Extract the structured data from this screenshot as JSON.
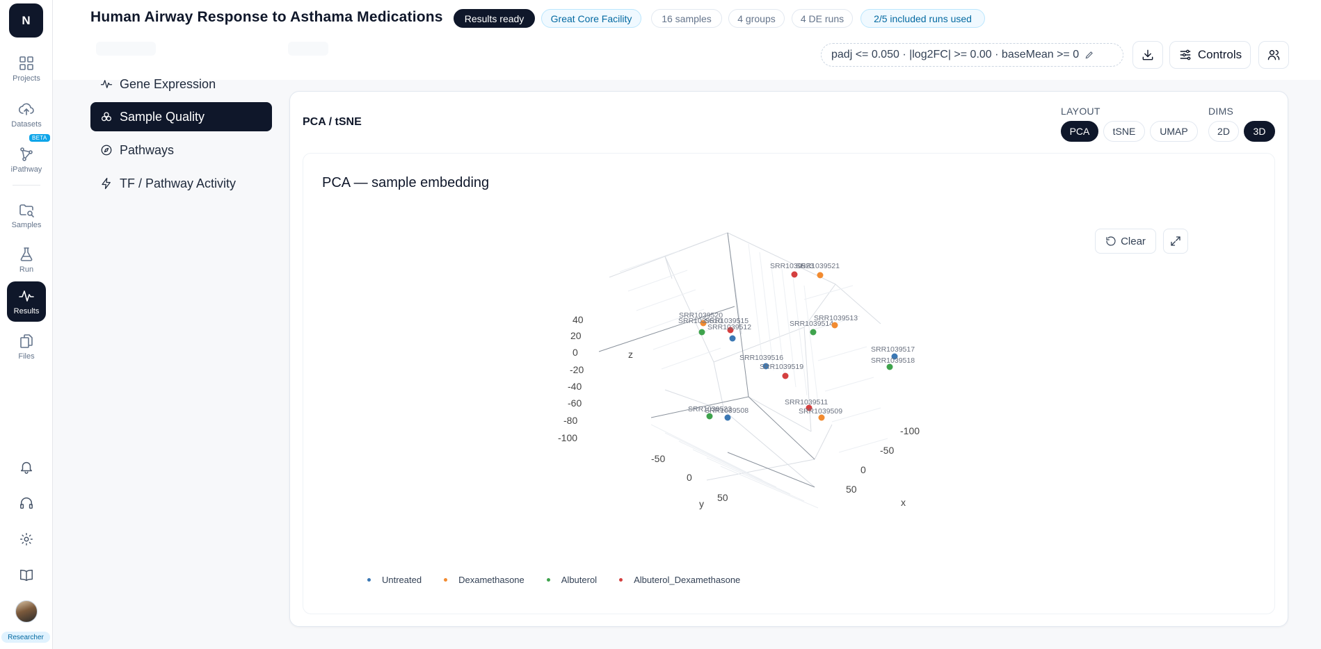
{
  "app": {
    "logo_letter": "N",
    "title": "Human Airway Response to Asthama Medications",
    "role": "Researcher"
  },
  "badges": {
    "status": "Results ready",
    "facility": "Great Core Facility",
    "samples": "16 samples",
    "groups": "4 groups",
    "de_runs": "4 DE runs",
    "runs_used": "2/5 included runs used"
  },
  "filter_text": "padj <= 0.050 · |log2FC| >= 0.00 · baseMean >= 0",
  "controls_label": "Controls",
  "rail": [
    {
      "label": "Projects",
      "icon": "grid-icon"
    },
    {
      "label": "Datasets",
      "icon": "cloud-upload-icon"
    },
    {
      "label": "iPathway",
      "icon": "network-icon"
    },
    {
      "label": "Samples",
      "icon": "folder-search-icon"
    },
    {
      "label": "Run",
      "icon": "flask-icon"
    },
    {
      "label": "Results",
      "icon": "activity-icon"
    },
    {
      "label": "Files",
      "icon": "files-icon"
    }
  ],
  "beta_label": "BETA",
  "subnav": [
    {
      "label": "Gene Expression",
      "icon": "activity-icon"
    },
    {
      "label": "Sample Quality",
      "icon": "circles-icon",
      "active": true
    },
    {
      "label": "Pathways",
      "icon": "compass-icon"
    },
    {
      "label": "TF / Pathway Activity",
      "icon": "zap-icon"
    }
  ],
  "panel": {
    "title": "PCA / tSNE",
    "layout_label": "LAYOUT",
    "layout_options": [
      "PCA",
      "tSNE",
      "UMAP"
    ],
    "layout_selected": "PCA",
    "dims_label": "DIMS",
    "dims_options": [
      "2D",
      "3D"
    ],
    "dims_selected": "3D",
    "plot_title": "PCA — sample embedding",
    "clear_label": "Clear"
  },
  "colors": {
    "Untreated": "#3b78b4",
    "Dexamethasone": "#f28b30",
    "Albuterol": "#3fa34d",
    "Albuterol_Dexamethasone": "#d43f3f",
    "accent_dark": "#0f172a"
  },
  "chart_data": {
    "type": "scatter",
    "projection": "3d",
    "title": "PCA — sample embedding",
    "xlabel": "x",
    "ylabel": "y",
    "zlabel": "z",
    "x_ticks": [
      -100,
      -50,
      0,
      50
    ],
    "y_ticks": [
      -50,
      0,
      50
    ],
    "z_ticks": [
      40,
      20,
      0,
      -20,
      -40,
      -60,
      -80,
      -100
    ],
    "legend": [
      "Untreated",
      "Dexamethasone",
      "Albuterol",
      "Albuterol_Dexamethasone"
    ],
    "legend_position": "bottom-left",
    "points": [
      {
        "label": "SRR1039523",
        "group": "Albuterol_Dexamethasone"
      },
      {
        "label": "SRR1039521",
        "group": "Dexamethasone"
      },
      {
        "label": "SRR1039520",
        "group": "Dexamethasone"
      },
      {
        "label": "SRR1039510",
        "group": "Albuterol"
      },
      {
        "label": "SRR1039515",
        "group": "Albuterol_Dexamethasone"
      },
      {
        "label": "SRR1039512",
        "group": "Untreated"
      },
      {
        "label": "SRR1039514",
        "group": "Albuterol"
      },
      {
        "label": "SRR1039513",
        "group": "Dexamethasone"
      },
      {
        "label": "SRR1039517",
        "group": "Untreated"
      },
      {
        "label": "SRR1039518",
        "group": "Albuterol"
      },
      {
        "label": "SRR1039516",
        "group": "Untreated"
      },
      {
        "label": "SRR1039519",
        "group": "Albuterol_Dexamethasone"
      },
      {
        "label": "SRR1039511",
        "group": "Albuterol_Dexamethasone"
      },
      {
        "label": "SRR1039509",
        "group": "Dexamethasone"
      },
      {
        "label": "SRR1039522",
        "group": "Albuterol"
      },
      {
        "label": "SRR1039508",
        "group": "Untreated"
      }
    ]
  }
}
